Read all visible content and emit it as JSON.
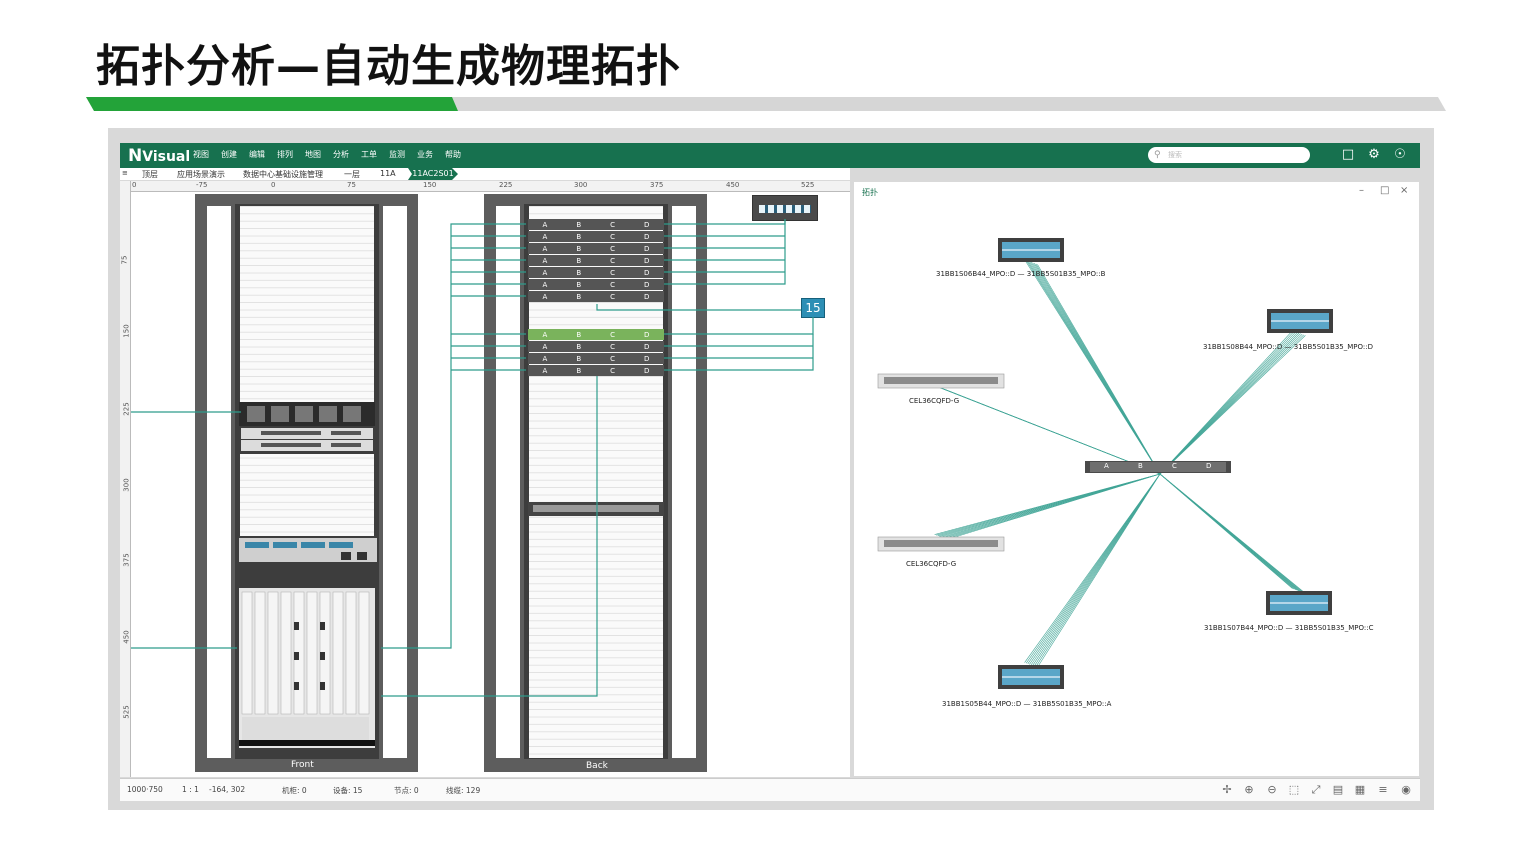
{
  "slide_title": "拓扑分析—自动生成物理拓扑",
  "colors": {
    "brand_green": "#17714f",
    "link_teal": "#2e9c8c",
    "rack_gray": "#5d5d5d",
    "accent_light_green": "#8dc63f"
  },
  "app": {
    "logo_n": "N",
    "logo_text": "Visual",
    "menu": [
      "视图",
      "创建",
      "编辑",
      "排列",
      "地图",
      "分析",
      "工单",
      "监测",
      "业务",
      "帮助"
    ],
    "search_placeholder": "搜索",
    "icons": [
      "chat-icon",
      "gear-icon",
      "user-icon"
    ]
  },
  "breadcrumb": [
    "顶层",
    "应用场景演示",
    "数据中心基础设施管理",
    "一层",
    "11A",
    "11AC2S01"
  ],
  "ruler_h": [
    "0",
    "-75",
    "0",
    "75",
    "150",
    "225",
    "300",
    "375",
    "450",
    "525"
  ],
  "ruler_v": [
    "75",
    "150",
    "225",
    "300",
    "375",
    "450",
    "525"
  ],
  "racks": {
    "front_label": "Front",
    "back_label": "Back",
    "panel_ports": [
      "A",
      "B",
      "C",
      "D"
    ],
    "badge": "15"
  },
  "topology": {
    "panel_title": "拓扑",
    "hub_ports": [
      "A",
      "B",
      "C",
      "D"
    ],
    "nodes": [
      {
        "label": "31BB1S06B44_MPO::D — 31BB5S01B35_MPO::B"
      },
      {
        "label": "31BB1S08B44_MPO::D — 31BB5S01B35_MPO::D"
      },
      {
        "label": "CEL36CQFD-G"
      },
      {
        "label": "CEL36CQFD-G"
      },
      {
        "label": "31BB1S07B44_MPO::D — 31BB5S01B35_MPO::C"
      },
      {
        "label": "31BB1S05B44_MPO::D — 31BB5S01B35_MPO::A"
      }
    ]
  },
  "status": {
    "size": "1000·750",
    "scale": "1 : 1",
    "coords": "-164, 302",
    "cabinets": "机柜: 0",
    "devices": "设备: 15",
    "nodes": "节点: 0",
    "links": "线缆: 129"
  }
}
